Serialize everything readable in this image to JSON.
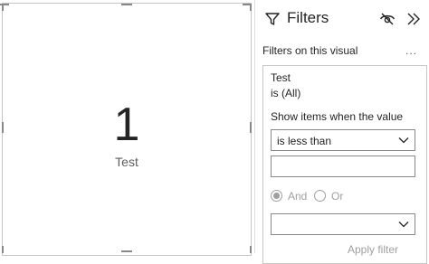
{
  "card": {
    "value": "1",
    "label": "Test"
  },
  "filters_pane": {
    "title": "Filters",
    "section_label": "Filters on this visual",
    "more_label": "...",
    "filter": {
      "field_name": "Test",
      "state": "is (All)",
      "show_items_label": "Show items when the value",
      "condition_1": "is less than",
      "value_1": "",
      "logic_options": [
        "And",
        "Or"
      ],
      "logic_selected": "And",
      "condition_2": "",
      "apply_label": "Apply filter"
    }
  },
  "colors": {
    "text": "#252423",
    "muted": "#605e5c",
    "disabled": "#a19f9d",
    "border": "#8a8886"
  },
  "icons": [
    "funnel-icon",
    "eye-off-icon",
    "double-chevron-right-icon",
    "chevron-down-icon"
  ]
}
